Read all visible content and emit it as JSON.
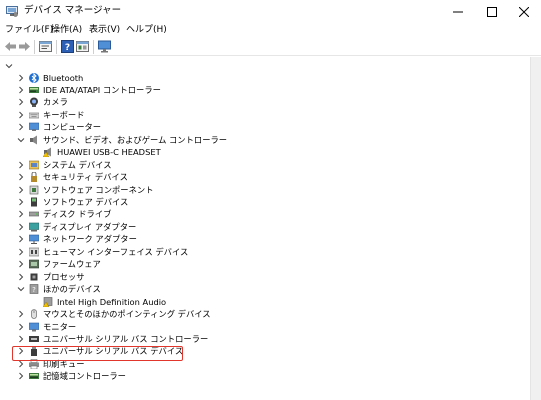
{
  "window": {
    "title": "デバイス マネージャー",
    "controls": [
      "minimize",
      "maximize",
      "close"
    ]
  },
  "menu": [
    "ファイル(F)",
    "操作(A)",
    "表示(V)",
    "ヘルプ(H)"
  ],
  "toolbar": {
    "buttons": [
      "back-icon",
      "forward-icon",
      "properties-icon",
      "help-icon",
      "view-icon",
      "monitor-icon"
    ]
  },
  "tree": {
    "items": [
      {
        "label": "Bluetooth",
        "icon": "bluetooth-icon",
        "expanded": false
      },
      {
        "label": "IDE ATA/ATAPI コントローラー",
        "icon": "ide-controller-icon",
        "expanded": false
      },
      {
        "label": "カメラ",
        "icon": "camera-icon",
        "expanded": false
      },
      {
        "label": "キーボード",
        "icon": "keyboard-icon",
        "expanded": false
      },
      {
        "label": "コンピューター",
        "icon": "computer-icon",
        "expanded": false
      },
      {
        "label": "サウンド、ビデオ、およびゲーム コントローラー",
        "icon": "speaker-icon",
        "expanded": true
      },
      {
        "label": "HUAWEI USB-C HEADSET",
        "icon": "warning-speaker-icon",
        "child": true
      },
      {
        "label": "システム デバイス",
        "icon": "system-device-icon",
        "expanded": false
      },
      {
        "label": "セキュリティ デバイス",
        "icon": "security-device-icon",
        "expanded": false
      },
      {
        "label": "ソフトウェア コンポーネント",
        "icon": "software-component-icon",
        "expanded": false
      },
      {
        "label": "ソフトウェア デバイス",
        "icon": "software-device-icon",
        "expanded": false
      },
      {
        "label": "ディスク ドライブ",
        "icon": "disk-drive-icon",
        "expanded": false
      },
      {
        "label": "ディスプレイ アダプター",
        "icon": "display-adapter-icon",
        "expanded": false
      },
      {
        "label": "ネットワーク アダプター",
        "icon": "network-adapter-icon",
        "expanded": false
      },
      {
        "label": "ヒューマン インターフェイス デバイス",
        "icon": "hid-icon",
        "expanded": false
      },
      {
        "label": "ファームウェア",
        "icon": "firmware-icon",
        "expanded": false
      },
      {
        "label": "プロセッサ",
        "icon": "processor-icon",
        "expanded": false
      },
      {
        "label": "ほかのデバイス",
        "icon": "other-devices-icon",
        "expanded": true
      },
      {
        "label": "Intel High Definition Audio",
        "icon": "warning-device-icon",
        "child": true
      },
      {
        "label": "マウスとそのほかのポインティング デバイス",
        "icon": "mouse-icon",
        "expanded": false
      },
      {
        "label": "モニター",
        "icon": "monitor-icon",
        "expanded": false
      },
      {
        "label": "ユニバーサル シリアル バス コントローラー",
        "icon": "usb-controller-icon",
        "expanded": false
      },
      {
        "label": "ユニバーサル シリアル バス デバイス",
        "icon": "usb-device-icon",
        "expanded": false,
        "highlighted": true
      },
      {
        "label": "印刷キュー",
        "icon": "printer-icon",
        "expanded": false
      },
      {
        "label": "記憶域コントローラー",
        "icon": "storage-controller-icon",
        "expanded": false
      }
    ]
  }
}
